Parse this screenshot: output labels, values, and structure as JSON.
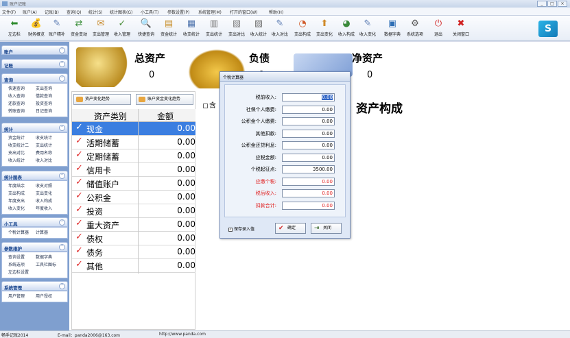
{
  "window": {
    "title": "账户记账"
  },
  "window_buttons": [
    "_",
    "□",
    "×"
  ],
  "menu": [
    "文件(F)",
    "账户(A)",
    "记账(B)",
    "查询(Q)",
    "统计(S)",
    "统计图表(G)",
    "小工具(T)",
    "参数设置(P)",
    "系统管理(M)",
    "打开的窗口(W)",
    "帮助(H)"
  ],
  "toolbar": [
    {
      "label": "左边栏",
      "icon": "arrow-left-icon",
      "glyph": "⬅",
      "color": "#2e8b2e"
    },
    {
      "label": "财务概览",
      "icon": "money-icon",
      "glyph": "💰",
      "color": "#d39a2b"
    },
    {
      "label": "账户精补",
      "icon": "account-icon",
      "glyph": "✎",
      "color": "#5f7fb5"
    },
    {
      "label": "资金变动",
      "icon": "transfer-icon",
      "glyph": "⇄",
      "color": "#3b8f3b"
    },
    {
      "label": "支出管理",
      "icon": "expense-icon",
      "glyph": "✉",
      "color": "#c88a2c"
    },
    {
      "label": "收入管理",
      "icon": "income-icon",
      "glyph": "✓",
      "color": "#4b8f3b"
    },
    {
      "label": "快捷查询",
      "icon": "search-icon",
      "glyph": "🔍",
      "color": "#6f8fbf"
    },
    {
      "label": "资金统计",
      "icon": "stats-icon",
      "glyph": "▤",
      "color": "#c8902c"
    },
    {
      "label": "收支统计",
      "icon": "chart-icon",
      "glyph": "▦",
      "color": "#4f74ad"
    },
    {
      "label": "支出统计",
      "icon": "report-icon",
      "glyph": "▥",
      "color": "#777"
    },
    {
      "label": "支出对比",
      "icon": "compare-icon",
      "glyph": "▧",
      "color": "#7a7a7a"
    },
    {
      "label": "收入统计",
      "icon": "income-stats-icon",
      "glyph": "▨",
      "color": "#6a6a6a"
    },
    {
      "label": "收入对比",
      "icon": "income-compare-icon",
      "glyph": "✎",
      "color": "#5f7fb5"
    },
    {
      "label": "支出构成",
      "icon": "pie-icon",
      "glyph": "◔",
      "color": "#d05a2a"
    },
    {
      "label": "支出变化",
      "icon": "trend-icon",
      "glyph": "⬆",
      "color": "#d08a2a"
    },
    {
      "label": "收入构成",
      "icon": "income-pie-icon",
      "glyph": "◕",
      "color": "#3a8a3a"
    },
    {
      "label": "收入变化",
      "icon": "income-trend-icon",
      "glyph": "✎",
      "color": "#5f7fb5"
    },
    {
      "label": "数据字典",
      "icon": "dictionary-icon",
      "glyph": "▣",
      "color": "#2f6fb5"
    },
    {
      "label": "系统选项",
      "icon": "gear-icon",
      "glyph": "⚙",
      "color": "#555"
    },
    {
      "label": "退出",
      "icon": "power-icon",
      "glyph": "⏻",
      "color": "#d02020"
    },
    {
      "label": "关闭窗口",
      "icon": "close-icon",
      "glyph": "✖",
      "color": "#d02020"
    }
  ],
  "sidebar": [
    {
      "title": "账户",
      "links": []
    },
    {
      "title": "记账",
      "links": []
    },
    {
      "title": "查询",
      "links": [
        "快速查询",
        "支出查询",
        "收入查询",
        "借款查询",
        "还款查询",
        "投资查询",
        "转账查询",
        "日记查询"
      ]
    },
    {
      "title": "统计",
      "links": [
        "资金统计",
        "收支统计",
        "收支统计二",
        "支出统计",
        "支出对比",
        "费用名称",
        "收入统计",
        "收入对比"
      ]
    },
    {
      "title": "统计图表",
      "links": [
        "年度结余",
        "收支对照",
        "支出构成",
        "支出变化",
        "年度支出",
        "收入构成",
        "收入变化",
        "年度收入"
      ]
    },
    {
      "title": "小工具",
      "links": [
        "个税计算器",
        "计算器"
      ]
    },
    {
      "title": "参数维护",
      "links": [
        "查询设置",
        "数据字典",
        "系统选项",
        "工具栏图标",
        "左边栏设置"
      ]
    },
    {
      "title": "系统管理",
      "links": [
        "用户管理",
        "用户授权"
      ]
    }
  ],
  "summary": {
    "total_assets_label": "总资产",
    "total_assets_value": "0",
    "liabilities_label": "负债",
    "liabilities_value": "0",
    "net_assets_label": "净资产",
    "net_assets_value": "0"
  },
  "buttons": {
    "asset_trend": "资产变化趋势",
    "account_trend": "账户资金变化趋势"
  },
  "table": {
    "headers": [
      "资产类别",
      "金额"
    ],
    "rows": [
      {
        "name": "现金",
        "amount": "0.00",
        "selected": true
      },
      {
        "name": "活期储蓄",
        "amount": "0.00"
      },
      {
        "name": "定期储蓄",
        "amount": "0.00"
      },
      {
        "name": "信用卡",
        "amount": "0.00"
      },
      {
        "name": "储值账户",
        "amount": "0.00"
      },
      {
        "name": "公积金",
        "amount": "0.00"
      },
      {
        "name": "投资",
        "amount": "0.00"
      },
      {
        "name": "重大资产",
        "amount": "0.00"
      },
      {
        "name": "债权",
        "amount": "0.00"
      },
      {
        "name": "债务",
        "amount": "0.00"
      },
      {
        "name": "其他",
        "amount": "0.00"
      }
    ]
  },
  "right": {
    "include_checkbox": "含",
    "composition_title": "资产构成"
  },
  "dialog": {
    "title": "个税计算器",
    "fields": [
      {
        "label": "税前收入:",
        "value": "0.00",
        "red": false,
        "selected": true
      },
      {
        "label": "社保个人缴费:",
        "value": "0.00",
        "red": false
      },
      {
        "label": "公积金个人缴费:",
        "value": "0.00",
        "red": false
      },
      {
        "label": "其他扣款:",
        "value": "0.00",
        "red": false
      },
      {
        "label": "公积金还贷利息:",
        "value": "0.00",
        "red": false
      },
      {
        "label": "应税金额:",
        "value": "0.00",
        "red": false
      },
      {
        "label": "个税起征点:",
        "value": "3500.00",
        "red": false
      },
      {
        "label": "应缴个税:",
        "value": "0.00",
        "red": true
      },
      {
        "label": "税后收入:",
        "value": "0.00",
        "red": true
      },
      {
        "label": "扣款合计:",
        "value": "0.00",
        "red": true
      }
    ],
    "save_checkbox": "保存录入值",
    "ok_button": "确定",
    "close_button": "关闭"
  },
  "status": {
    "app": "畅手记账2014",
    "email": "E-mail：panda2006@163.com",
    "url": "http://www.panda.com"
  }
}
